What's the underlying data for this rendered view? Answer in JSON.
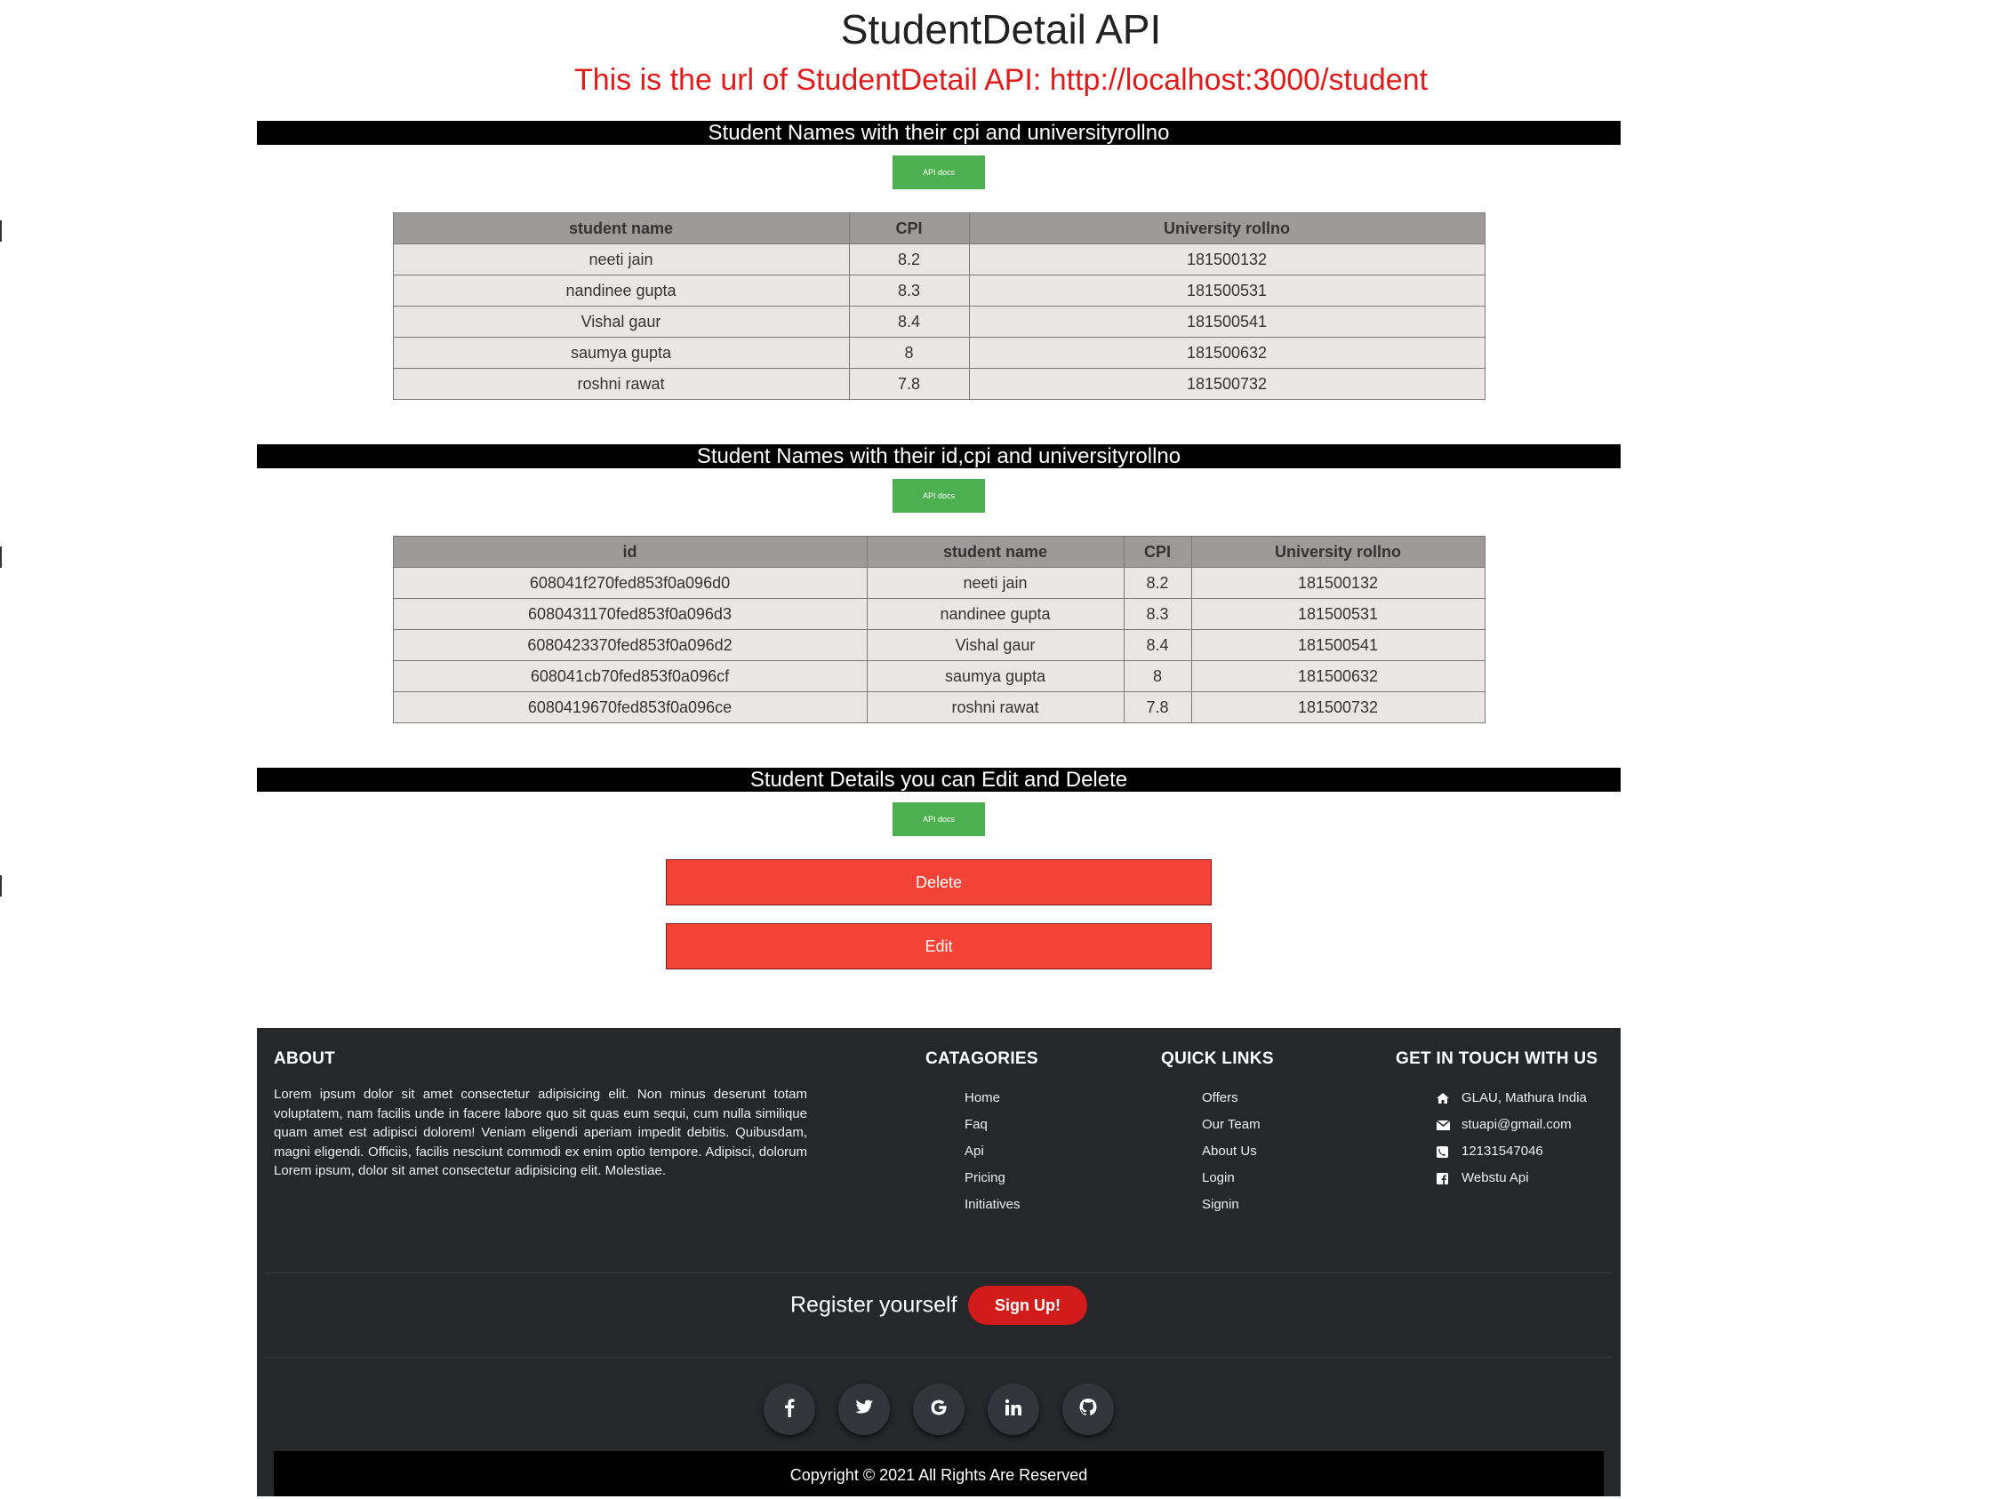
{
  "page": {
    "title": "StudentDetail API",
    "subtitle": "This is the url of StudentDetail API: http://localhost:3000/student"
  },
  "sections": [
    {
      "header": "Student Names with their cpi and universityrollno",
      "api_button": "API docs",
      "columns": [
        "student name",
        "CPI",
        "University rollno"
      ],
      "rows": [
        [
          "neeti jain",
          "8.2",
          "181500132"
        ],
        [
          "nandinee gupta",
          "8.3",
          "181500531"
        ],
        [
          "Vishal gaur",
          "8.4",
          "181500541"
        ],
        [
          "saumya gupta",
          "8",
          "181500632"
        ],
        [
          "roshni rawat",
          "7.8",
          "181500732"
        ]
      ]
    },
    {
      "header": "Student Names with their id,cpi and universityrollno",
      "api_button": "API docs",
      "columns": [
        "id",
        "student name",
        "CPI",
        "University rollno"
      ],
      "rows": [
        [
          "608041f270fed853f0a096d0",
          "neeti jain",
          "8.2",
          "181500132"
        ],
        [
          "6080431170fed853f0a096d3",
          "nandinee gupta",
          "8.3",
          "181500531"
        ],
        [
          "6080423370fed853f0a096d2",
          "Vishal gaur",
          "8.4",
          "181500541"
        ],
        [
          "608041cb70fed853f0a096cf",
          "saumya gupta",
          "8",
          "181500632"
        ],
        [
          "6080419670fed853f0a096ce",
          "roshni rawat",
          "7.8",
          "181500732"
        ]
      ]
    },
    {
      "header": "Student Details you can Edit and Delete",
      "api_button": "API docs",
      "delete_label": "Delete",
      "edit_label": "Edit"
    }
  ],
  "footer": {
    "about": {
      "heading": "ABOUT",
      "text": "Lorem ipsum dolor sit amet consectetur adipisicing elit. Non minus deserunt totam voluptatem, nam facilis unde in facere labore quo sit quas eum sequi, cum nulla similique quam amet est adipisci dolorem! Veniam eligendi aperiam impedit debitis. Quibusdam, magni eligendi. Officiis, facilis nesciunt commodi ex enim optio tempore. Adipisci, dolorum Lorem ipsum, dolor sit amet consectetur adipisicing elit. Molestiae."
    },
    "categories": {
      "heading": "CATAGORIES",
      "items": [
        "Home",
        "Faq",
        "Api",
        "Pricing",
        "Initiatives"
      ]
    },
    "quick_links": {
      "heading": "QUICK LINKS",
      "items": [
        "Offers",
        "Our Team",
        "About Us",
        "Login",
        "Signin"
      ]
    },
    "contact": {
      "heading": "GET IN TOUCH WITH US",
      "items": [
        {
          "icon": "home-icon",
          "text": "GLAU, Mathura India"
        },
        {
          "icon": "envelope-icon",
          "text": "stuapi@gmail.com"
        },
        {
          "icon": "phone-icon",
          "text": "12131547046"
        },
        {
          "icon": "facebook-icon",
          "text": "Webstu Api"
        }
      ]
    },
    "register_text": "Register yourself",
    "signup_label": "Sign Up!",
    "socials": [
      "facebook-icon",
      "twitter-icon",
      "google-icon",
      "linkedin-icon",
      "github-icon"
    ],
    "copyright": "Copyright © 2021 All Rights Are Reserved"
  },
  "colors": {
    "api_button": "#4caf50",
    "action_button": "#f44336",
    "subtitle": "#e01b1b",
    "footer_bg": "#26272b",
    "signup": "#d21c1c"
  }
}
